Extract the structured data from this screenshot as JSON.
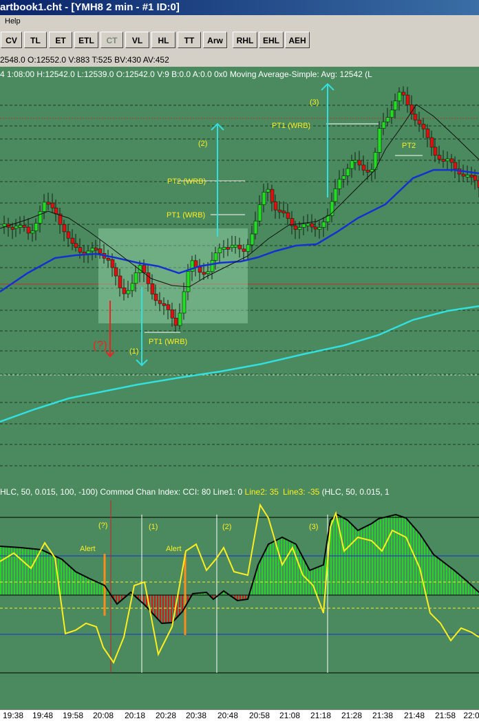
{
  "window": {
    "title": "artbook1.cht - [YMH8  2 min  - #1  ID:0]"
  },
  "menu": {
    "items": [
      "Help"
    ]
  },
  "toolbar": {
    "buttons": [
      "CV",
      "TL",
      "ET",
      "ETL",
      "CT",
      "VL",
      "HL",
      "TT",
      "Arw",
      "RHL",
      "EHL",
      "AEH"
    ],
    "dimmed": [
      "CT"
    ]
  },
  "quote_bar": {
    "text": "2548.0  O:12552.0  V:883  T:525  BV:430  AV:452"
  },
  "price_chart": {
    "header": "4   1:08:00   H:12542.0   L:12539.0   O:12542.0   V:9   B:0.0   A:0.0   0x0   Moving Average-Simple:  Avg: 12542   (L",
    "annotations": {
      "pt2_wrb": "PT2 (WRB)",
      "pt1_wrb": "PT1 (WRB)",
      "pt1_wrb_low": "PT1 (WRB)",
      "pt1_wrb_high": "PT1 (WRB)",
      "pt2": "PT2",
      "label_q": "(?)",
      "label_1": "(1)",
      "label_2": "(2)",
      "label_3": "(3)"
    },
    "colors": {
      "background": "#4a8a5e",
      "up_candle": "#22dd22",
      "down_candle": "#dd1111",
      "ma_fast": "#101010",
      "ma_mid": "#1530d0",
      "ma_slow": "#33e0e0",
      "arrow": "#33e0e0",
      "red_arrow": "#ee2222",
      "annotation": "#ffee22"
    }
  },
  "cci_chart": {
    "header": {
      "part1": "HLC, 50, 0.015, 100, -100)   Commod Chan Index:  CCI: 80   Line1: 0  ",
      "line2": "Line2: 35",
      "line3": "Line3: -35",
      "part4": "   (HLC, 50, 0.015, 1"
    },
    "markers": [
      "(?)",
      "(1)",
      "(2)",
      "(3)"
    ],
    "alerts": [
      "Alert",
      "Alert"
    ]
  },
  "time_axis": {
    "labels": [
      "19:38",
      "19:48",
      "19:58",
      "20:08",
      "20:18",
      "20:28",
      "20:38",
      "20:48",
      "20:58",
      "21:08",
      "21:18",
      "21:28",
      "21:38",
      "21:48",
      "21:58",
      "22:0"
    ]
  }
}
